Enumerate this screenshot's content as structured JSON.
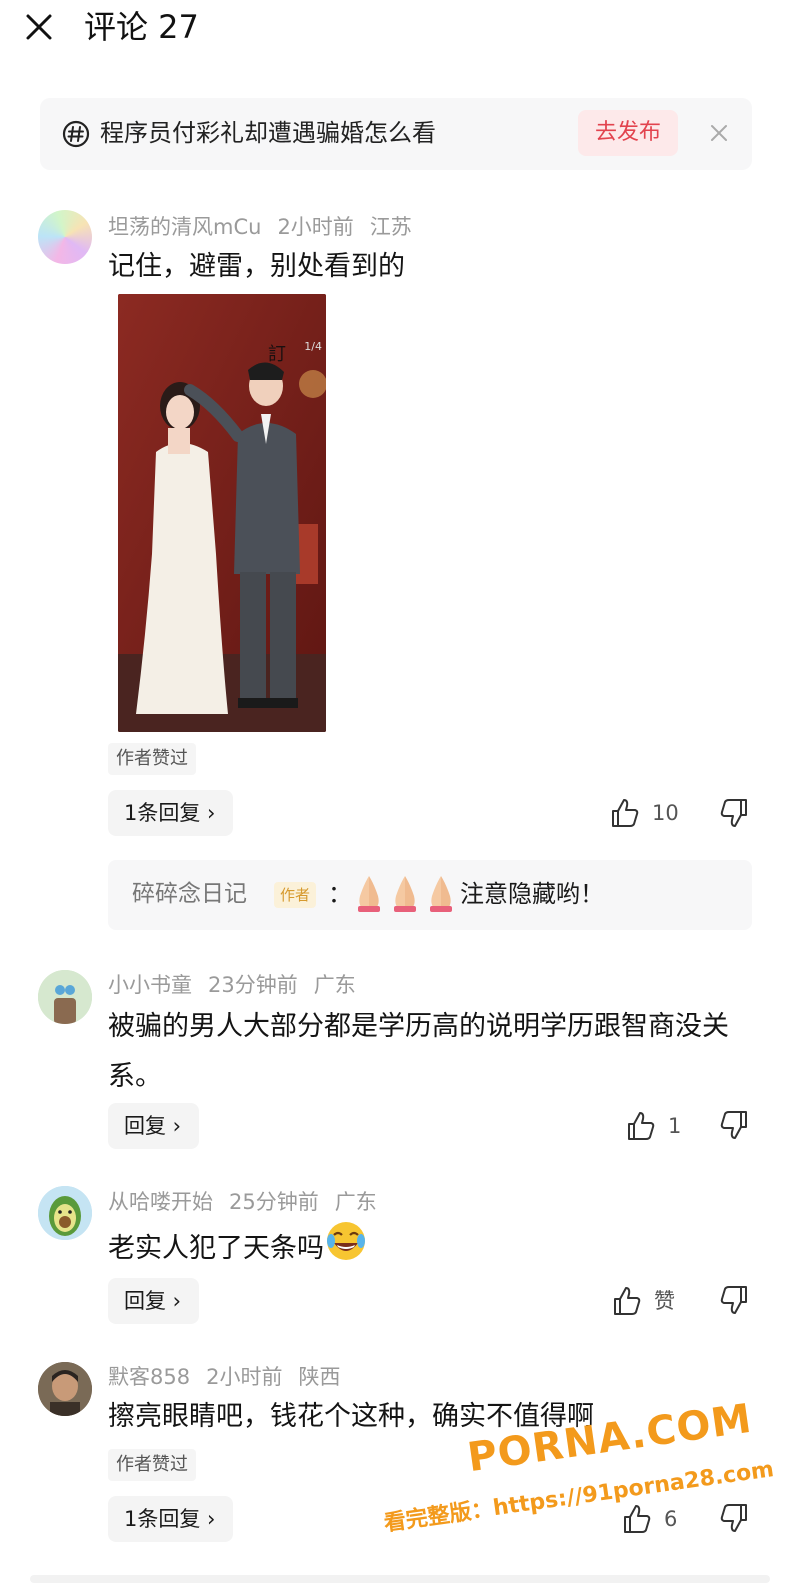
{
  "header": {
    "title": "评论 27"
  },
  "topic": {
    "text": "程序员付彩礼却遭遇骗婚怎么看",
    "publish_label": "去发布"
  },
  "comments": [
    {
      "user": "坦荡的清风mCu",
      "time": "2小时前",
      "location": "江苏",
      "text": "记住，避雷，别处看到的",
      "image_counter": "1/4",
      "author_liked": "作者赞过",
      "reply_label": "1条回复 ›",
      "likes": "10",
      "sub_reply": {
        "author": "碎碎念日记",
        "tag": "作者",
        "colon": "：",
        "text": "注意隐藏哟！"
      }
    },
    {
      "user": "小小书童",
      "time": "23分钟前",
      "location": "广东",
      "text": "被骗的男人大部分都是学历高的说明学历跟智商没关系。",
      "reply_label": "回复 ›",
      "likes": "1"
    },
    {
      "user": "从哈喽开始",
      "time": "25分钟前",
      "location": "广东",
      "text": "老实人犯了天条吗",
      "reply_label": "回复 ›",
      "likes": "赞"
    },
    {
      "user": "默客858",
      "time": "2小时前",
      "location": "陕西",
      "text": "擦亮眼睛吧，钱花个这种，确实不值得啊",
      "author_liked": "作者赞过",
      "reply_label": "1条回复 ›",
      "likes": "6"
    }
  ],
  "watermark": {
    "big": "PORNA.COM",
    "small": "看完整版：https://91porna28.com"
  },
  "colors": {
    "accent": "#e2434e",
    "accent_bg": "#fde9ea",
    "meta": "#9a9a9a",
    "watermark": "#f39a1c"
  }
}
